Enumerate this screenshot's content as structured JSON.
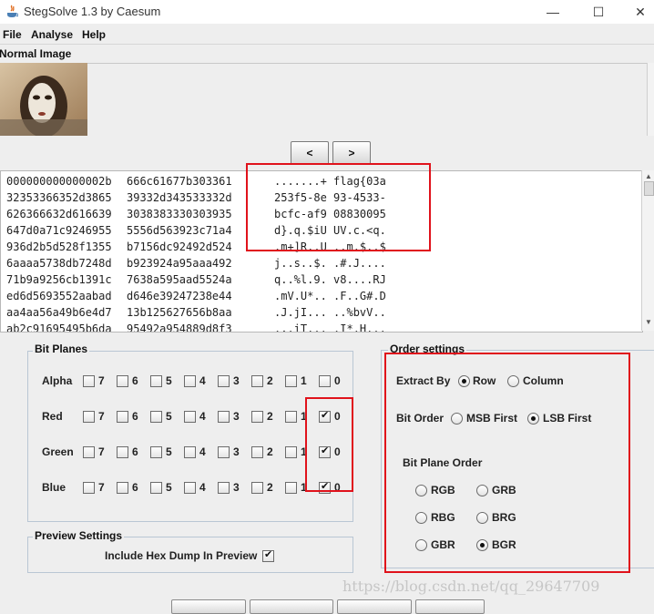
{
  "window": {
    "title": "StegSolve 1.3 by Caesum",
    "minimize": "—",
    "maximize": "☐",
    "close": "✕"
  },
  "menu": [
    "File",
    "Analyse",
    "Help"
  ],
  "section_label": "Normal Image",
  "nav": {
    "prev": "<",
    "next": ">"
  },
  "hex_dump": [
    {
      "a": "000000000000002b",
      "b": "666c61677b303361",
      "c": ".......+ flag{03a"
    },
    {
      "a": "32353366352d3865",
      "b": "39332d343533332d",
      "c": "253f5-8e 93-4533-"
    },
    {
      "a": "626366632d616639",
      "b": "3038383330303935",
      "c": "bcfc-af9 08830095"
    },
    {
      "a": "647d0a71c9246955",
      "b": "5556d563923c71a4",
      "c": "d}.q.$iU UV.c.<q."
    },
    {
      "a": "936d2b5d528f1355",
      "b": "b7156dc92492d524",
      "c": ".m+]R..U ..m.$..$"
    },
    {
      "a": "6aaaa5738db7248d",
      "b": "b923924a95aaa492",
      "c": "j..s..$. .#.J...."
    },
    {
      "a": "71b9a9256cb1391c",
      "b": "7638a595aad5524a",
      "c": "q..%l.9. v8....RJ"
    },
    {
      "a": "ed6d5693552aabad",
      "b": "d646e39247238e44",
      "c": ".mV.U*.. .F..G#.D"
    },
    {
      "a": "aa4aa56a49b6e4d7",
      "b": "13b125627656b8aa",
      "c": ".J.jI... ..%bvV.."
    },
    {
      "a": "ab2c91695495b6da",
      "b": "95492a954889d8f3",
      "c": ".,.iT... .I*.H..."
    }
  ],
  "bit_planes": {
    "title": "Bit Planes",
    "bits": [
      "7",
      "6",
      "5",
      "4",
      "3",
      "2",
      "1",
      "0"
    ],
    "rows": [
      {
        "label": "Alpha",
        "checked": [
          false,
          false,
          false,
          false,
          false,
          false,
          false,
          false
        ]
      },
      {
        "label": "Red",
        "checked": [
          false,
          false,
          false,
          false,
          false,
          false,
          false,
          true
        ]
      },
      {
        "label": "Green",
        "checked": [
          false,
          false,
          false,
          false,
          false,
          false,
          false,
          true
        ]
      },
      {
        "label": "Blue",
        "checked": [
          false,
          false,
          false,
          false,
          false,
          false,
          false,
          true
        ]
      }
    ]
  },
  "preview": {
    "title": "Preview Settings",
    "label": "Include Hex Dump In Preview",
    "checked": true
  },
  "order": {
    "title": "Order settings",
    "extract_by": {
      "label": "Extract By",
      "options": [
        "Row",
        "Column"
      ],
      "selected": "Row"
    },
    "bit_order": {
      "label": "Bit Order",
      "options": [
        "MSB First",
        "LSB First"
      ],
      "selected": "LSB First"
    },
    "plane_order": {
      "label": "Bit Plane Order",
      "options": [
        "RGB",
        "GRB",
        "RBG",
        "BRG",
        "GBR",
        "BGR"
      ],
      "selected": "BGR"
    }
  },
  "watermark": "https://blog.csdn.net/qq_29647709",
  "colors": {
    "highlight": "#e0121b",
    "window_bg": "#eeeeee",
    "panel_border": "#b9c6d4"
  }
}
